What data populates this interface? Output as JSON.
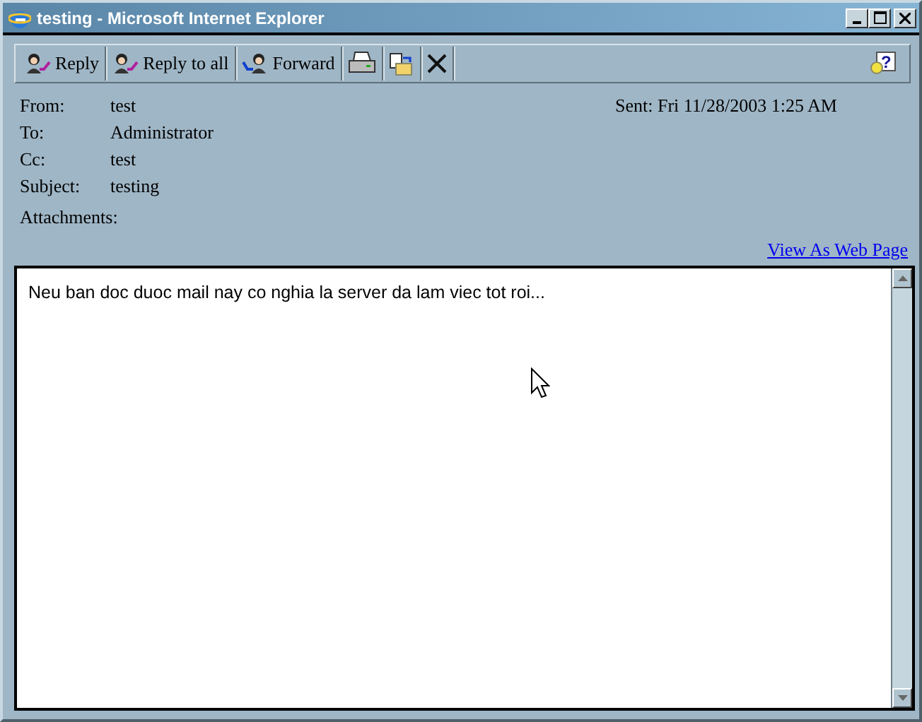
{
  "window": {
    "title": "testing - Microsoft Internet Explorer"
  },
  "toolbar": [
    {
      "kind": "reply",
      "label": "Reply"
    },
    {
      "kind": "reply-all",
      "label": "Reply to all"
    },
    {
      "kind": "forward",
      "label": "Forward"
    },
    {
      "kind": "print"
    },
    {
      "kind": "move"
    },
    {
      "kind": "delete"
    }
  ],
  "help_mark": "?",
  "headers": [
    {
      "label": "From:",
      "value": "test"
    },
    {
      "label": "To:",
      "value": "Administrator"
    },
    {
      "label": "Cc:",
      "value": "test"
    },
    {
      "label": "Subject:",
      "value": "testing"
    }
  ],
  "sent": "Sent: Fri 11/28/2003 1:25 AM",
  "attachments_label": "Attachments:",
  "view_link": "View As Web Page",
  "body": "Neu ban doc duoc mail nay co nghia la server da lam viec tot roi..."
}
